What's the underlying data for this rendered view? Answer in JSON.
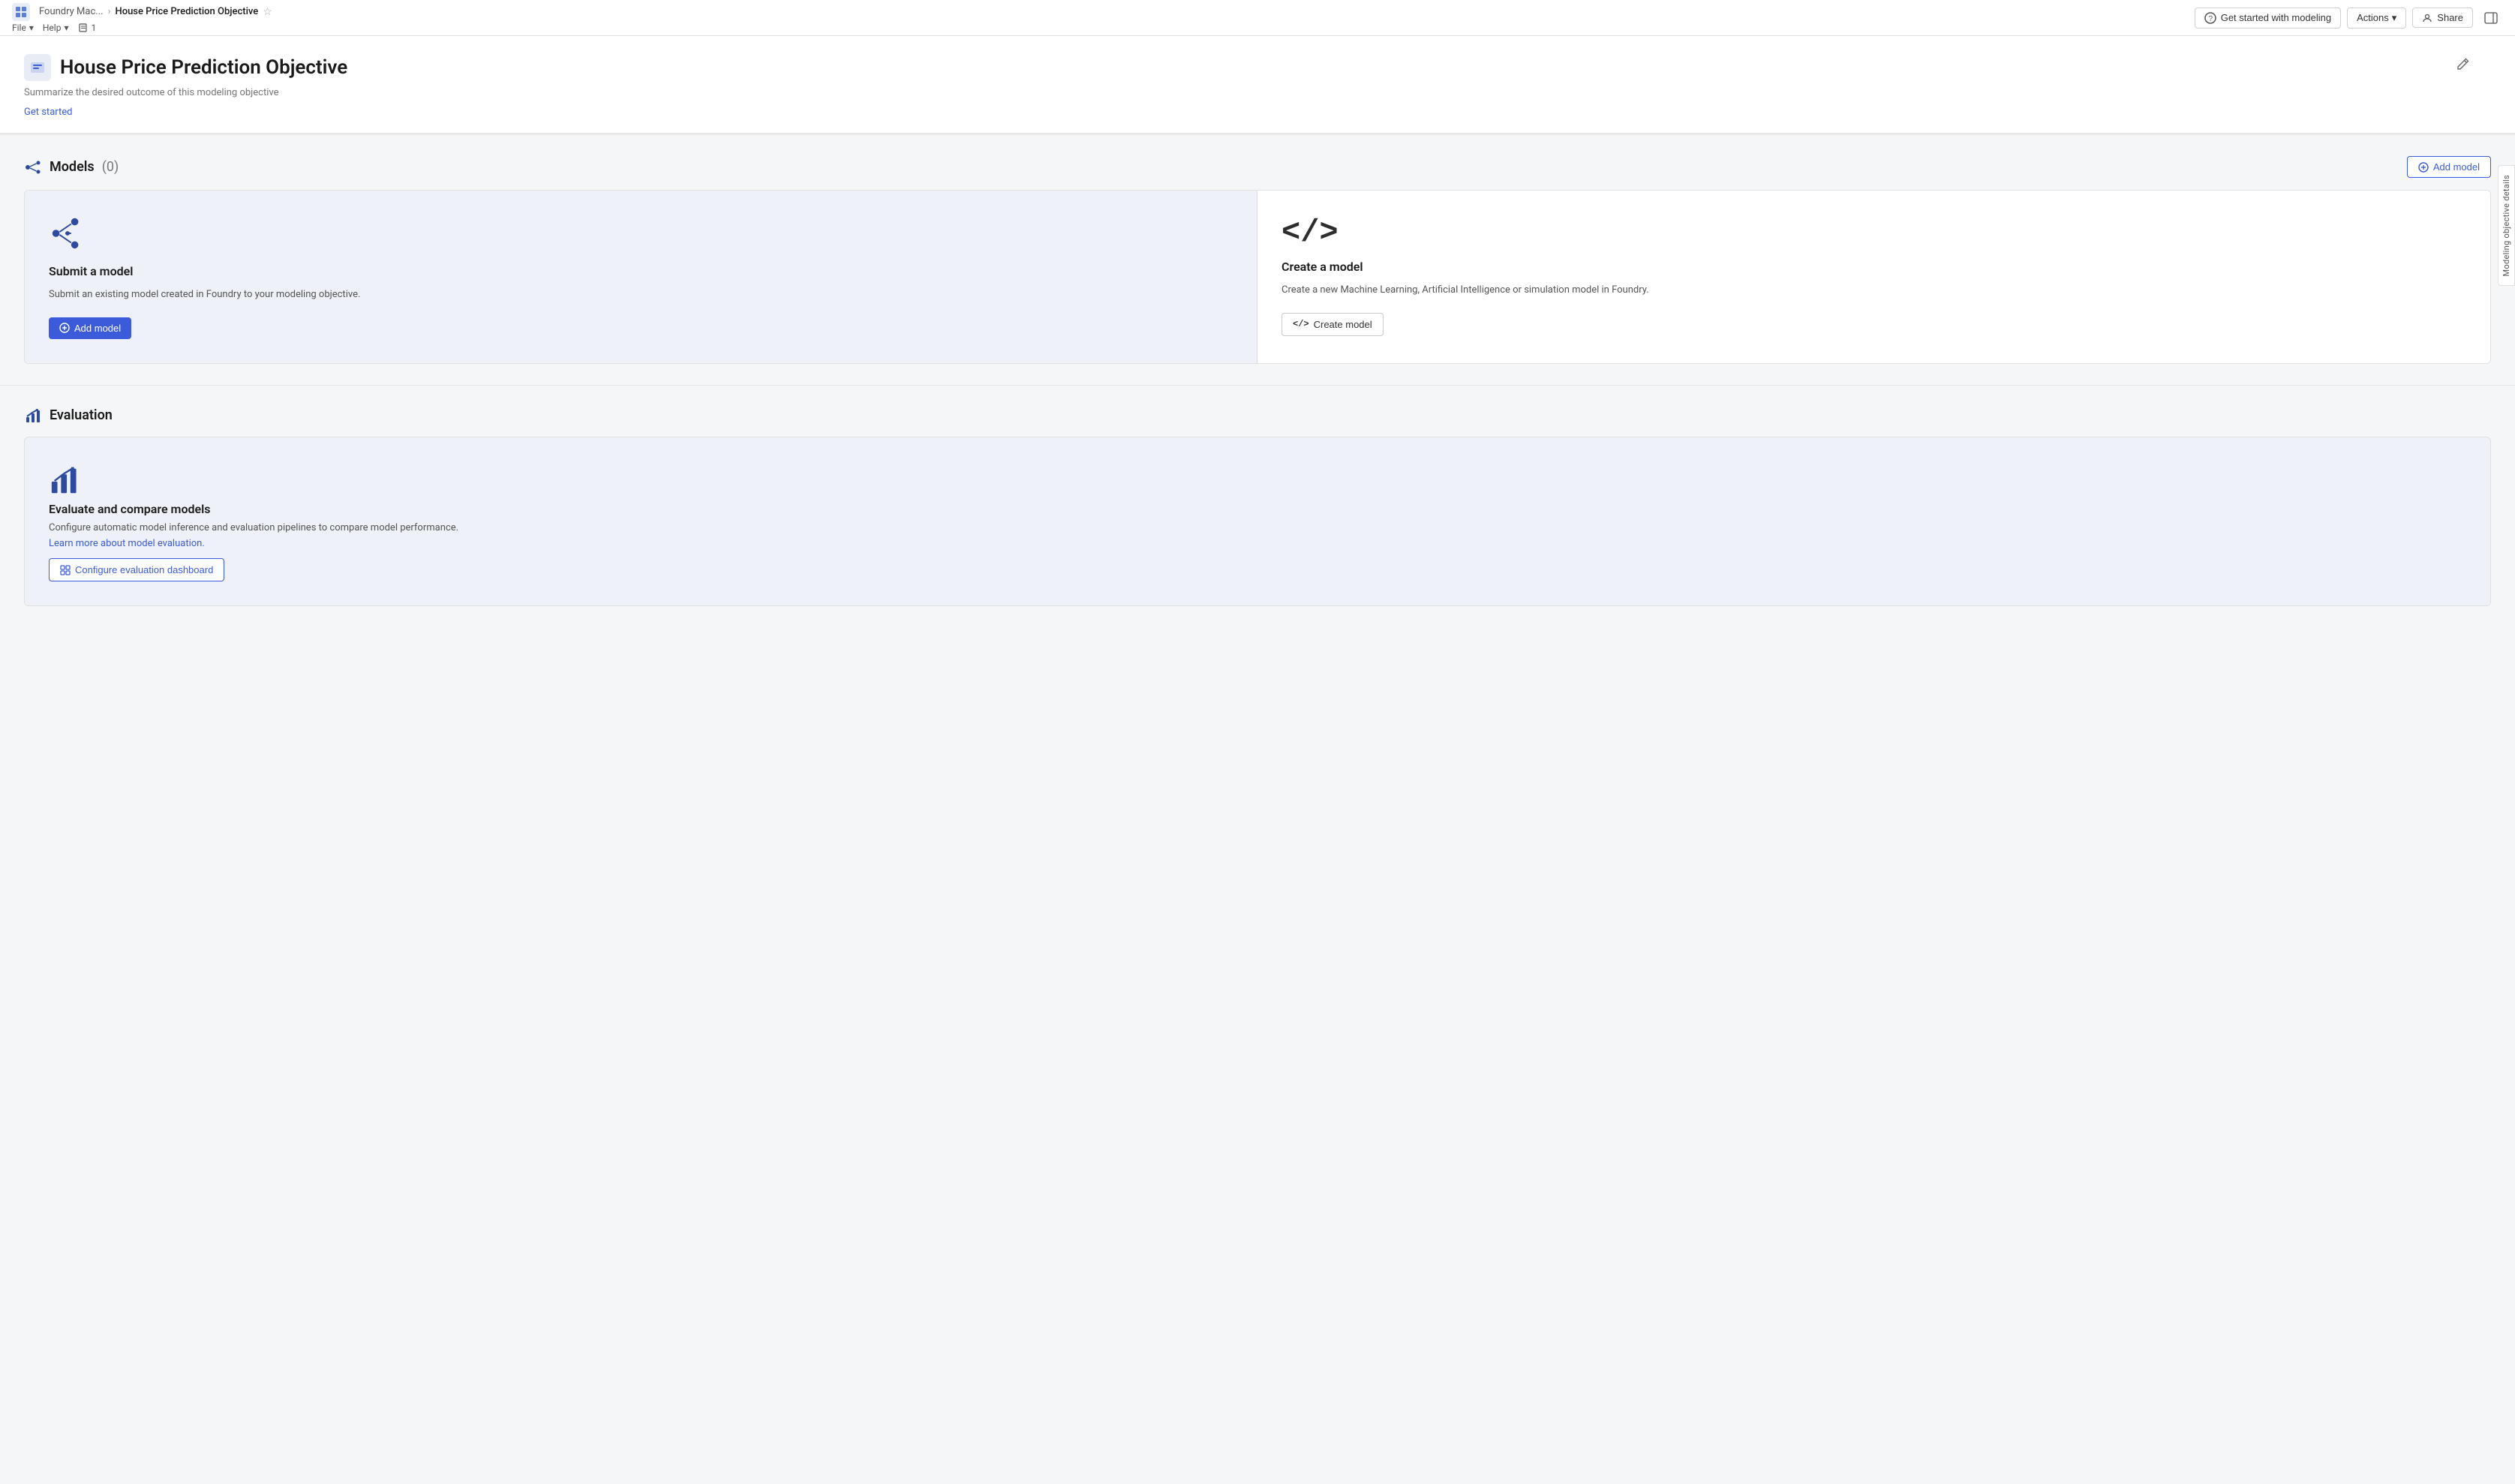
{
  "appName": "Foundry Mac...",
  "breadcrumb": {
    "parent": "Foundry Mac...",
    "current": "House Price Prediction Objective"
  },
  "topbar": {
    "getStartedLabel": "Get started with modeling",
    "actionsLabel": "Actions",
    "shareLabel": "Share",
    "fileMenu": "File",
    "helpMenu": "Help",
    "versionBadge": "1"
  },
  "sidePanelTab": "Modeling objective details",
  "pageHeader": {
    "title": "House Price Prediction Objective",
    "subtitle": "Summarize the desired outcome of this modeling objective",
    "getStartedLink": "Get started"
  },
  "modelsSection": {
    "title": "Models",
    "count": "(0)",
    "addModelLabel": "Add model"
  },
  "submitCard": {
    "title": "Submit a model",
    "description": "Submit an existing model created in Foundry to your modeling objective.",
    "buttonLabel": "Add model"
  },
  "createCard": {
    "title": "Create a model",
    "description": "Create a new Machine Learning, Artificial Intelligence or simulation model in Foundry.",
    "buttonLabel": "Create model"
  },
  "evaluationSection": {
    "title": "Evaluation",
    "card": {
      "title": "Evaluate and compare models",
      "description": "Configure automatic model inference and evaluation pipelines to compare model performance.",
      "learnMoreLink": "Learn more about model evaluation.",
      "buttonLabel": "Configure evaluation dashboard"
    }
  },
  "icons": {
    "question": "?",
    "chevronDown": "▾",
    "userIcon": "👤",
    "panelIcon": "☰",
    "starIcon": "☆",
    "plusCircle": "⊕",
    "pencilIcon": "✏",
    "codeTag": "</>",
    "barChartIcon": "📊",
    "addModelIcon": "⊕",
    "configureIcon": "⊞"
  }
}
